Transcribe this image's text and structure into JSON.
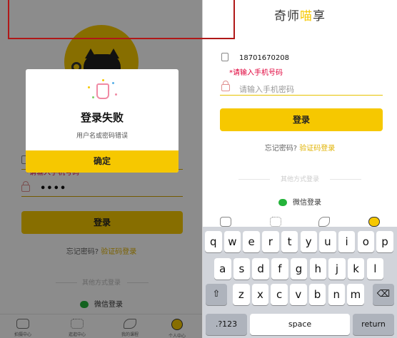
{
  "left": {
    "error": "*请输入手机号码",
    "password_mask": "••••",
    "login_button": "登录",
    "forgot_prefix": "忘记密码?",
    "forgot_code": "验证码登录",
    "other_methods": "其他方式登录",
    "wechat": "微信登录",
    "tabs": [
      "拍摄中心",
      "逛逛中心",
      "我的课程",
      "个人中心"
    ],
    "dialog": {
      "title": "登录失败",
      "message": "用户名或密码错误",
      "confirm": "确定"
    }
  },
  "right": {
    "brand_pre": "奇师",
    "brand_hl": "喵",
    "brand_post": "享",
    "phone_value": "18701670208",
    "error": "*请输入手机号码",
    "password_placeholder": "请输入手机密码",
    "login_button": "登录",
    "forgot_prefix": "忘记密码?",
    "forgot_code": "验证码登录",
    "other_methods": "其他方式登录",
    "wechat": "微信登录"
  },
  "keyboard": {
    "row1": [
      "q",
      "w",
      "e",
      "r",
      "t",
      "y",
      "u",
      "i",
      "o",
      "p"
    ],
    "row2": [
      "a",
      "s",
      "d",
      "f",
      "g",
      "h",
      "j",
      "k",
      "l"
    ],
    "row3": [
      "z",
      "x",
      "c",
      "v",
      "b",
      "n",
      "m"
    ],
    "shift": "⇧",
    "delete": "⌫",
    "numbers": ".?123",
    "space": "space",
    "return": "return"
  },
  "colors": {
    "accent": "#f6c800",
    "error": "#e0003a",
    "highlight_box": "#b01818"
  }
}
